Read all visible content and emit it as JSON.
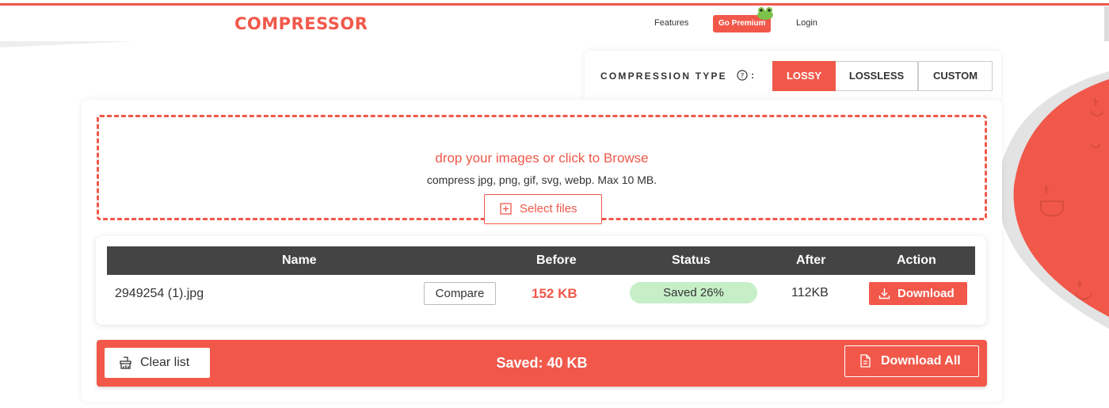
{
  "header": {
    "logo": "COMPRESSOR",
    "nav": {
      "features": "Features",
      "premium": "Go Premium",
      "login": "Login"
    }
  },
  "compression": {
    "label": "COMPRESSION TYPE",
    "colon": ":",
    "options": [
      "LOSSY",
      "LOSSLESS",
      "CUSTOM"
    ],
    "selected": "LOSSY"
  },
  "dropzone": {
    "title": "drop your images or click to Browse",
    "subtitle": "compress jpg, png, gif, svg, webp. Max 10 MB.",
    "select_button": "Select files"
  },
  "table": {
    "columns": [
      "Name",
      "Before",
      "Status",
      "After",
      "Action"
    ],
    "rows": [
      {
        "name": "2949254 (1).jpg",
        "compare": "Compare",
        "before": "152 KB",
        "status": "Saved 26%",
        "after": "112KB",
        "action": "Download"
      }
    ]
  },
  "footer": {
    "clear": "Clear list",
    "saved": "Saved: 40 KB",
    "download_all": "Download All"
  },
  "colors": {
    "accent": "#f1584a",
    "header_dark": "#444444",
    "status_bg": "#c6efc8"
  },
  "icons": {
    "help": "help-circle-icon",
    "plus": "plus-square-icon",
    "download": "download-icon",
    "clear": "broom-icon",
    "file": "file-icon"
  }
}
